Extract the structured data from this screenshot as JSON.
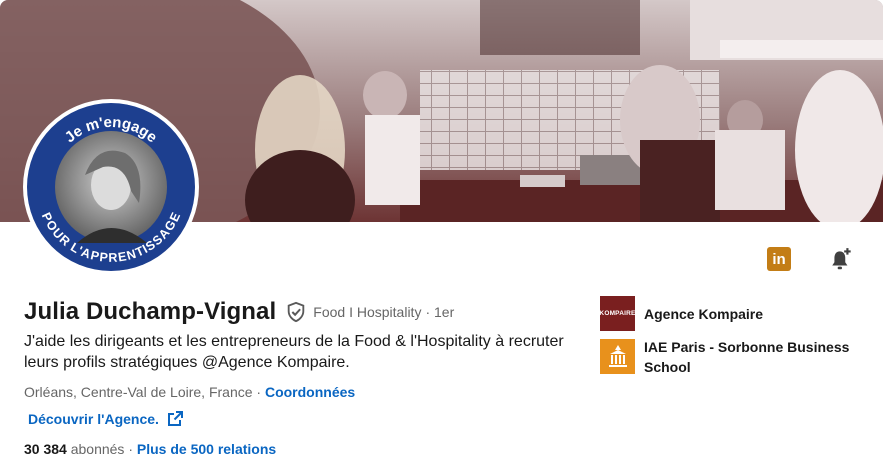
{
  "profile": {
    "badge_top": "Je m'engage",
    "badge_bottom": "POUR L'APPRENTISSAGE",
    "name": "Julia Duchamp-Vignal",
    "pronoun": "Food I Hospitality",
    "degree": "· 1er",
    "headline": "J'aide les dirigeants et les entrepreneurs de la Food & l'Hospitality à recruter leurs profils stratégiques @Agence Kompaire.",
    "location": "Orléans, Centre-Val de Loire, France ·",
    "contact_label": "Coordonnées",
    "website_label": "Découvrir l'Agence.",
    "followers_count": "30 384",
    "followers_label": "abonnés",
    "relations_sep": "·",
    "relations_label": "Plus de 500 relations"
  },
  "actions": {
    "linkedin_icon_label": "in"
  },
  "side": {
    "items": [
      {
        "label": "Agence Kompaire",
        "logo_text": "KOMPAIRE",
        "logo": "company-logo-kompaire"
      },
      {
        "label": "IAE Paris - Sorbonne Business School",
        "logo": "school-logo-iae"
      }
    ]
  },
  "colors": {
    "link": "#0a66c2",
    "badge_blue": "#1d3f8f",
    "kompaire": "#7a1f1f",
    "iae": "#e8911c",
    "linkedin_icon": "#c37d16"
  },
  "icons": [
    "verified-shield-icon",
    "external-link-icon",
    "bell-plus-icon",
    "linkedin-icon"
  ]
}
